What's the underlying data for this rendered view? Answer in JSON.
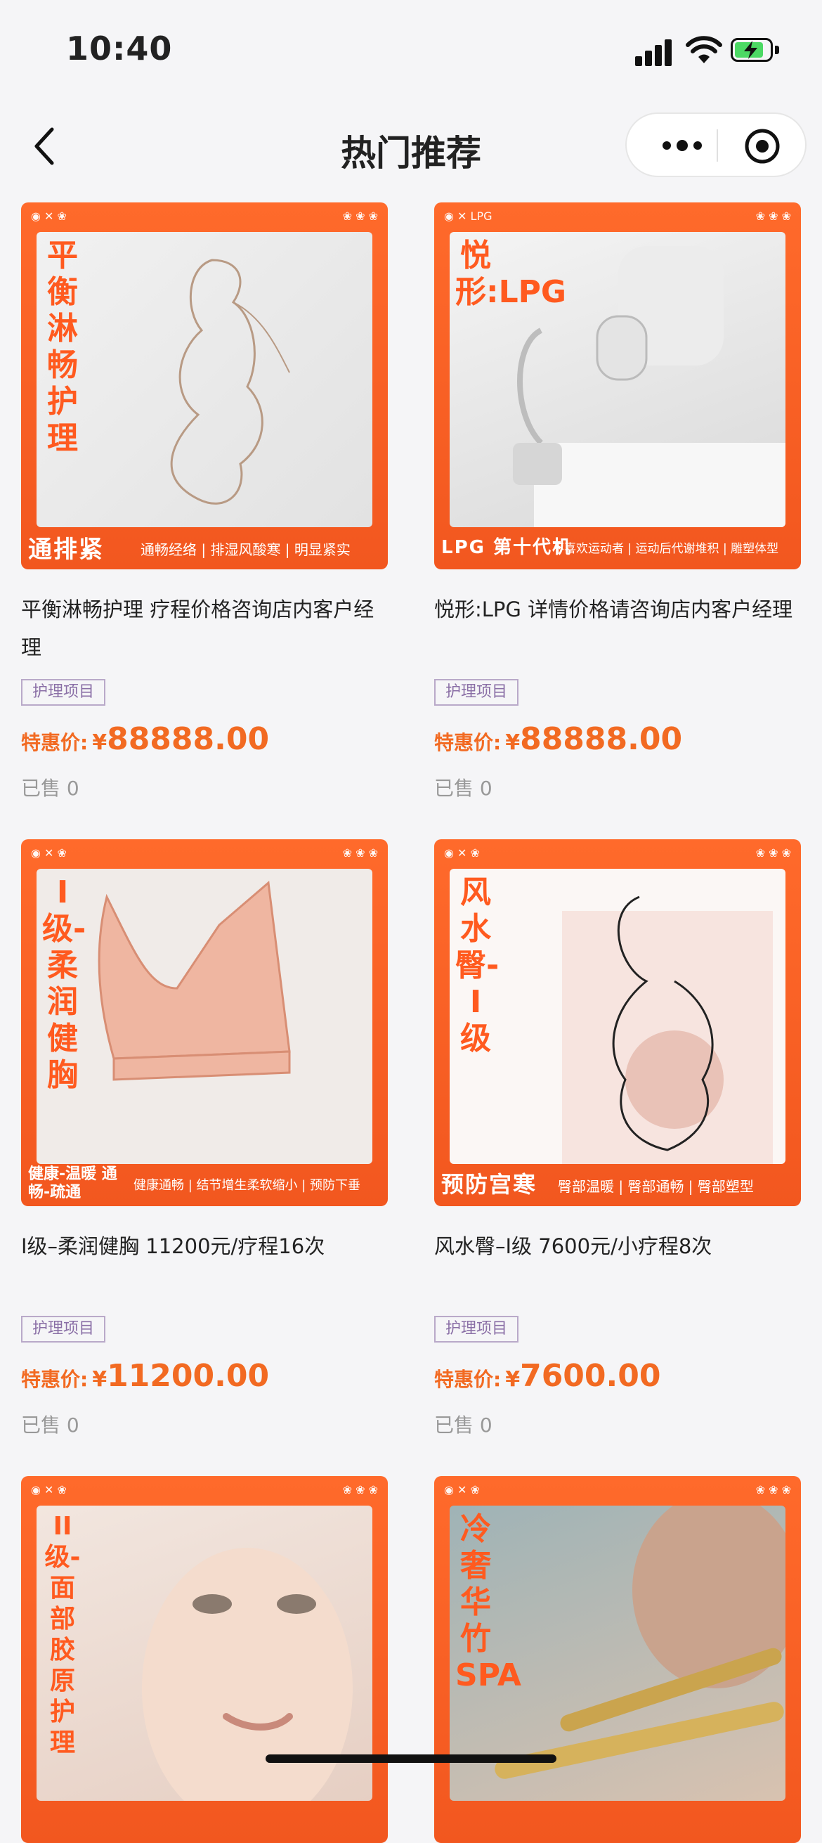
{
  "status": {
    "time": "10:40"
  },
  "nav": {
    "title": "热门推荐"
  },
  "products": [
    {
      "cover_title": "平衡淋畅护理",
      "cover_badge": "通排紧",
      "cover_features": "通畅经络 | 排湿风酸寒 | 明显紧实",
      "title": "平衡淋畅护理 疗程价格咨询店内客户经理",
      "tag": "护理项目",
      "price_label": "特惠价:",
      "currency": "¥",
      "price": "88888.00",
      "sold": "已售 0"
    },
    {
      "cover_title": "悦形:LPG",
      "cover_badge": "LPG 第十代机",
      "cover_features": "不喜欢运动者 | 运动后代谢堆积 | 雕塑体型",
      "title": "悦形:LPG 详情价格请咨询店内客户经理",
      "tag": "护理项目",
      "price_label": "特惠价:",
      "currency": "¥",
      "price": "88888.00",
      "sold": "已售 0"
    },
    {
      "cover_title": "I级-柔润健胸",
      "cover_badge": "健康-温暖 通畅-疏通",
      "cover_features": "健康通畅 | 结节增生柔软缩小 | 预防下垂",
      "title": "I级–柔润健胸 11200元/疗程16次",
      "tag": "护理项目",
      "price_label": "特惠价:",
      "currency": "¥",
      "price": "11200.00",
      "sold": "已售 0"
    },
    {
      "cover_title": "风水臀-I级",
      "cover_badge": "预防宫寒",
      "cover_features": "臀部温暖 | 臀部通畅 | 臀部塑型",
      "title": "风水臀–I级 7600元/小疗程8次",
      "tag": "护理项目",
      "price_label": "特惠价:",
      "currency": "¥",
      "price": "7600.00",
      "sold": "已售 0"
    },
    {
      "cover_title": "II级-面部胶原护理",
      "cover_badge": "",
      "cover_features": "",
      "title": "",
      "tag": "",
      "price_label": "",
      "currency": "",
      "price": "",
      "sold": ""
    },
    {
      "cover_title": "冷奢华竹SPA",
      "cover_badge": "",
      "cover_features": "",
      "title": "",
      "tag": "",
      "price_label": "",
      "currency": "",
      "price": "",
      "sold": ""
    }
  ],
  "colors": {
    "accent": "#f26a22",
    "cover_orange": "#ff6a2b",
    "tag_border": "#b9a9c9"
  }
}
